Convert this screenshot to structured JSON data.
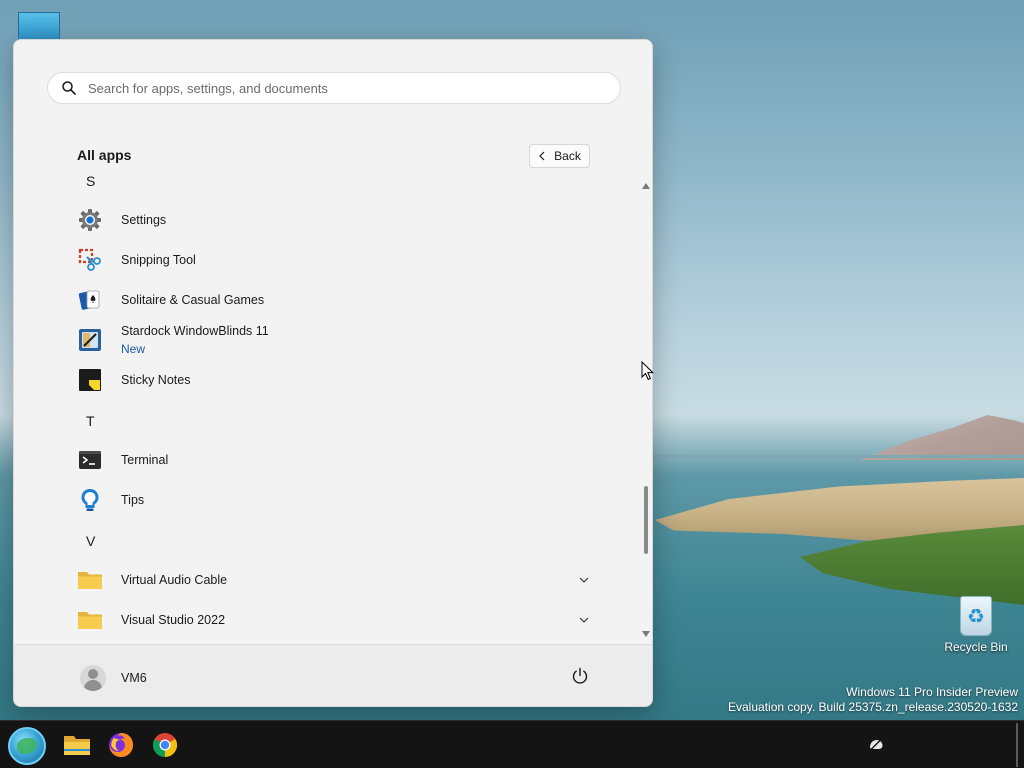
{
  "desktop": {
    "recycle_bin_label": "Recycle Bin",
    "watermark_line1": "Windows 11 Pro Insider Preview",
    "watermark_line2": "Evaluation copy. Build 25375.zn_release.230520-1632"
  },
  "start_menu": {
    "search_placeholder": "Search for apps, settings, and documents",
    "section_title": "All apps",
    "back_label": "Back",
    "groups": [
      {
        "letter": "S",
        "apps": [
          {
            "name": "Settings",
            "icon": "settings-gear-icon"
          },
          {
            "name": "Snipping Tool",
            "icon": "snipping-tool-icon"
          },
          {
            "name": "Solitaire & Casual Games",
            "icon": "solitaire-cards-icon"
          },
          {
            "name": "Stardock WindowBlinds 11",
            "badge": "New",
            "icon": "windowblinds-icon"
          },
          {
            "name": "Sticky Notes",
            "icon": "sticky-notes-icon"
          }
        ]
      },
      {
        "letter": "T",
        "apps": [
          {
            "name": "Terminal",
            "icon": "terminal-icon"
          },
          {
            "name": "Tips",
            "icon": "tips-bulb-icon"
          }
        ]
      },
      {
        "letter": "V",
        "apps": [
          {
            "name": "Virtual Audio Cable",
            "icon": "folder-icon",
            "expandable": true
          },
          {
            "name": "Visual Studio 2022",
            "icon": "folder-icon",
            "expandable": true
          }
        ]
      }
    ],
    "user_name": "VM6"
  },
  "taskbar": {
    "items": [
      "start-orb",
      "file-explorer",
      "firefox",
      "chrome"
    ]
  },
  "colors": {
    "menu_bg": "#f3f3f3",
    "accent_blue": "#1b5aa8",
    "taskbar_bg": "#141414"
  }
}
